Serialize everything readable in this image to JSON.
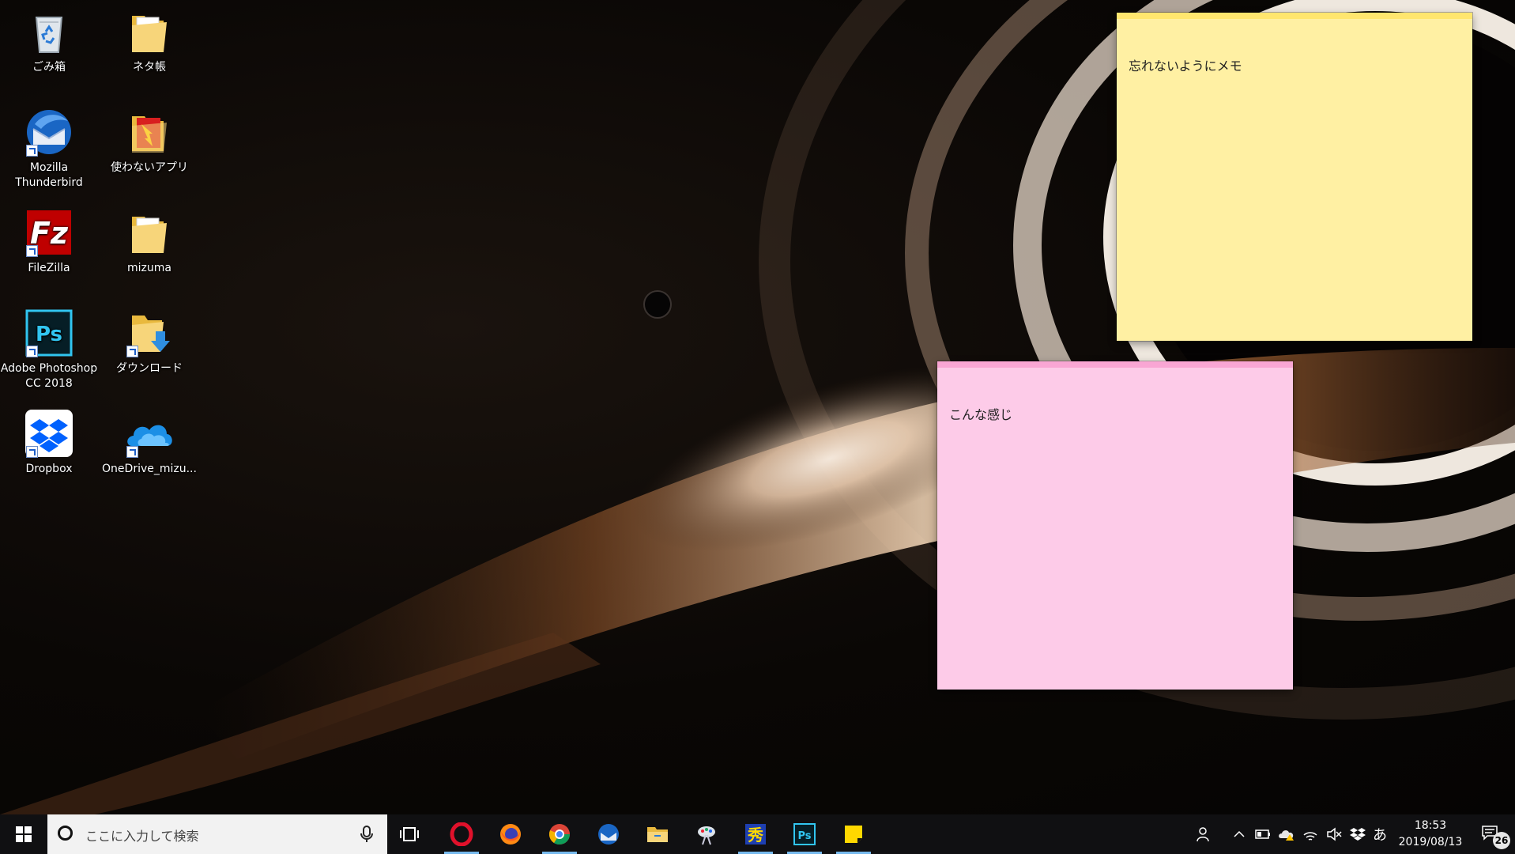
{
  "desktop": {
    "icons": [
      {
        "label": "ごみ箱"
      },
      {
        "label": "ネタ帳"
      },
      {
        "label": "Mozilla\nThunderbird"
      },
      {
        "label": "使わないアプリ"
      },
      {
        "label": "FileZilla"
      },
      {
        "label": "mizuma"
      },
      {
        "label": "Adobe Photoshop\nCC 2018"
      },
      {
        "label": "ダウンロード"
      },
      {
        "label": "Dropbox"
      },
      {
        "label": "OneDrive_mizu..."
      }
    ]
  },
  "notes": {
    "yellow": {
      "text": "忘れないようにメモ",
      "color": "#fff0a3",
      "bar_color": "#ffe66e"
    },
    "pink": {
      "text": "こんな感じ",
      "color": "#fdcbe8",
      "bar_color": "#f9a6d4"
    }
  },
  "taskbar": {
    "search_placeholder": "ここに入力して検索",
    "pinned_apps": [
      "opera",
      "firefox",
      "chrome",
      "thunderbird",
      "file-explorer",
      "paint-app",
      "hidemaru",
      "photoshop",
      "sticky-notes"
    ],
    "ime_label": "あ",
    "time": "18:53",
    "date": "2019/08/13",
    "notification_count": "26",
    "accent_color": "#76b9ed"
  }
}
